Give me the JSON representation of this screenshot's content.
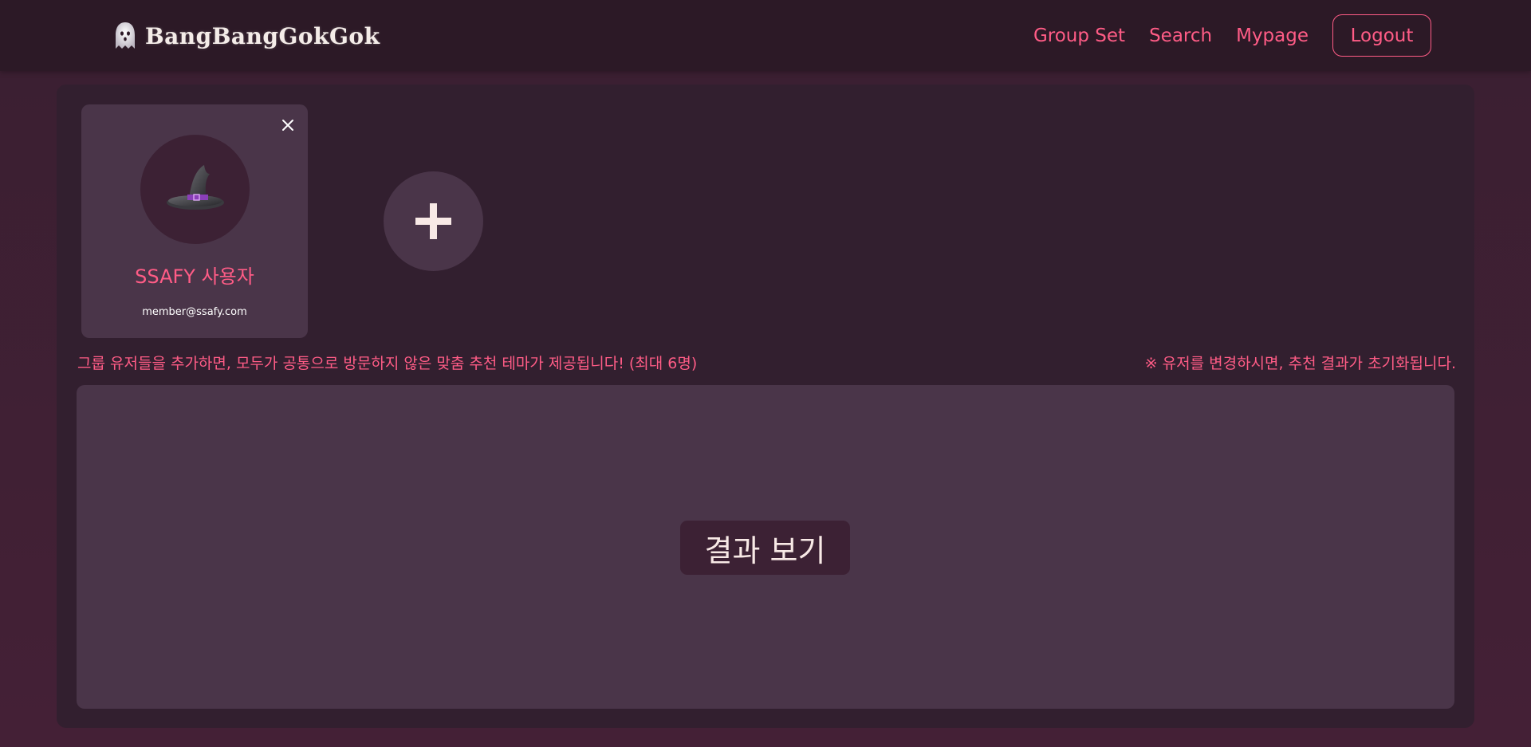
{
  "navbar": {
    "brand_name": "BangBangGokGok",
    "brand_icon": "ghost-icon",
    "links": [
      "Group Set",
      "Search",
      "Mypage"
    ],
    "logout_label": "Logout"
  },
  "group": {
    "members": [
      {
        "name": "SSAFY 사용자",
        "email": "member@ssafy.com",
        "avatar_icon": "witch-hat-icon",
        "remove_icon": "close-icon"
      }
    ],
    "add_icon": "plus-icon"
  },
  "info": {
    "left": "그룹 유저들을 추가하면, 모두가 공통으로 방문하지 않은 맞춤 추천 테마가 제공됩니다! (최대 6명)",
    "right": "※ 유저를 변경하시면, 추천 결과가 초기화됩니다."
  },
  "result": {
    "button_label": "결과 보기"
  },
  "colors": {
    "accent": "#ff5c86",
    "navbar_bg": "#2c1926",
    "panel_bg": "#321f2f",
    "card_bg": "#4a3549",
    "button_bg": "#3c2134"
  }
}
